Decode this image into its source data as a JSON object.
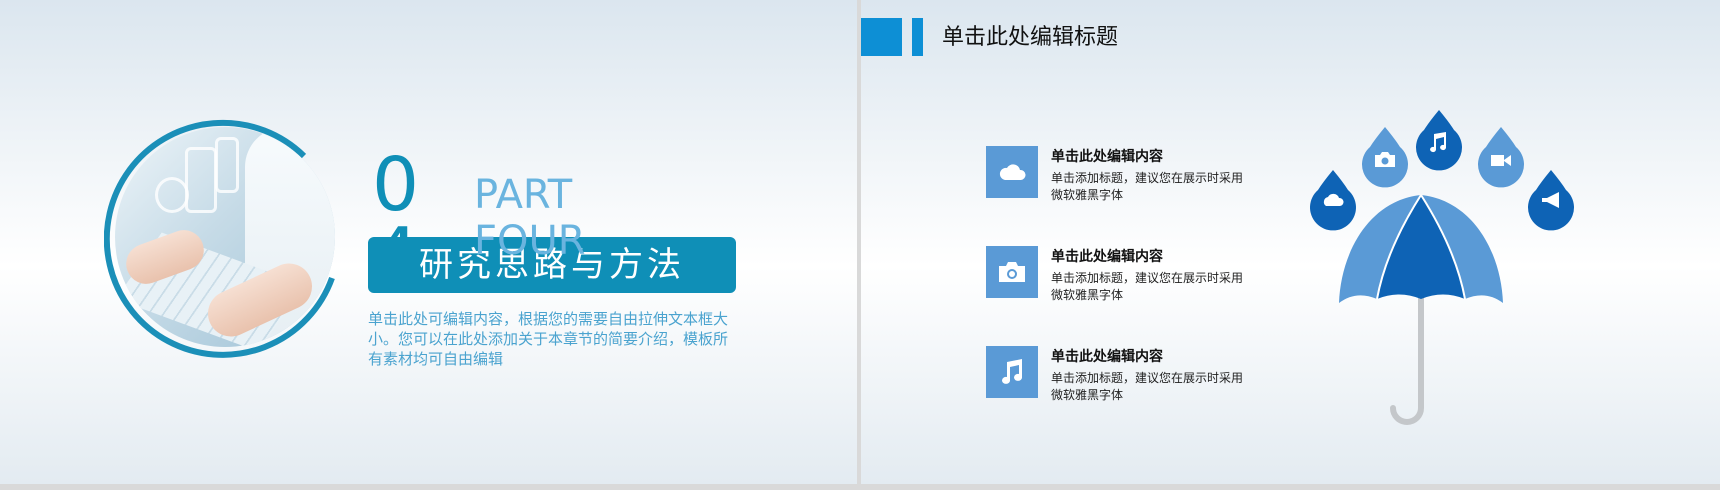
{
  "left_slide": {
    "part_number": "04",
    "part_word": "PART FOUR",
    "section_title": "研究思路与方法",
    "intro": "单击此处可编辑内容，根据您的需要自由拉伸文本框大小。您可以在此处添加关于本章节的简要介绍，模板所有素材均可自由编辑",
    "accent_color": "#0f8fb7"
  },
  "right_slide": {
    "title": "单击此处编辑标题",
    "accent_color": "#0d8fd5",
    "features": [
      {
        "icon": "cloud-icon",
        "heading": "单击此处编辑内容",
        "body": "单击添加标题，建议您在展示时采用微软雅黑字体"
      },
      {
        "icon": "camera-icon",
        "heading": "单击此处编辑内容",
        "body": "单击添加标题，建议您在展示时采用微软雅黑字体"
      },
      {
        "icon": "music-note-icon",
        "heading": "单击此处编辑内容",
        "body": "单击添加标题，建议您在展示时采用微软雅黑字体"
      }
    ],
    "umbrella_drops": [
      "cloud-icon",
      "camera-icon",
      "music-note-icon",
      "video-camera-icon",
      "megaphone-icon"
    ]
  }
}
